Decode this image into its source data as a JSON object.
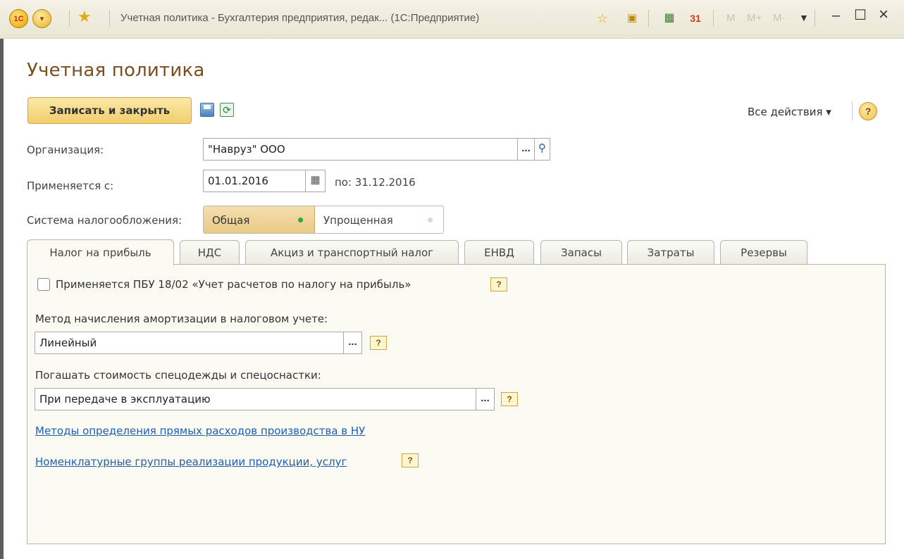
{
  "titlebar": {
    "logo_text": "1С",
    "window_title": "Учетная политика - Бухгалтерия предприятия, редак... (1С:Предприятие)",
    "m_buttons": [
      "M",
      "M+",
      "M-"
    ],
    "minimize": "–",
    "maximize": "☐",
    "close": "×"
  },
  "form": {
    "title": "Учетная политика",
    "save_close_label": "Записать и закрыть",
    "all_actions_label": "Все действия ▾",
    "help_label": "?"
  },
  "fields": {
    "organization_label": "Организация:",
    "organization_value": "\"Навруз\" ООО",
    "applies_from_label": "Применяется с:",
    "applies_from_value": "01.01.2016",
    "applies_to_text": "по: 31.12.2016",
    "tax_system_label": "Система налогообложения:",
    "tax_system_options": [
      "Общая",
      "Упрощенная"
    ],
    "tax_system_selected": "Общая"
  },
  "tabs": [
    "Налог на прибыль",
    "НДС",
    "Акциз и транспортный налог",
    "ЕНВД",
    "Запасы",
    "Затраты",
    "Резервы"
  ],
  "active_tab": "Налог на прибыль",
  "panel": {
    "pbu_checkbox_label": "Применяется ПБУ 18/02 «Учет расчетов по налогу на прибыль»",
    "pbu_checked": false,
    "amortization_label": "Метод начисления амортизации в налоговом учете:",
    "amortization_value": "Линейный",
    "workwear_label": "Погашать стоимость спецодежды и спецоснастки:",
    "workwear_value": "При передаче в эксплуатацию",
    "link_direct_costs": "Методы определения прямых расходов производства в НУ",
    "link_nomenclature": "Номенклатурные группы реализации продукции, услуг",
    "help_mark": "?",
    "ellipsis": "..."
  },
  "colors": {
    "title_brown": "#7c4e1b",
    "button_yellow": "#f2ce6d",
    "link_blue": "#1f5fb0",
    "selected_dot": "#2aa84a"
  }
}
